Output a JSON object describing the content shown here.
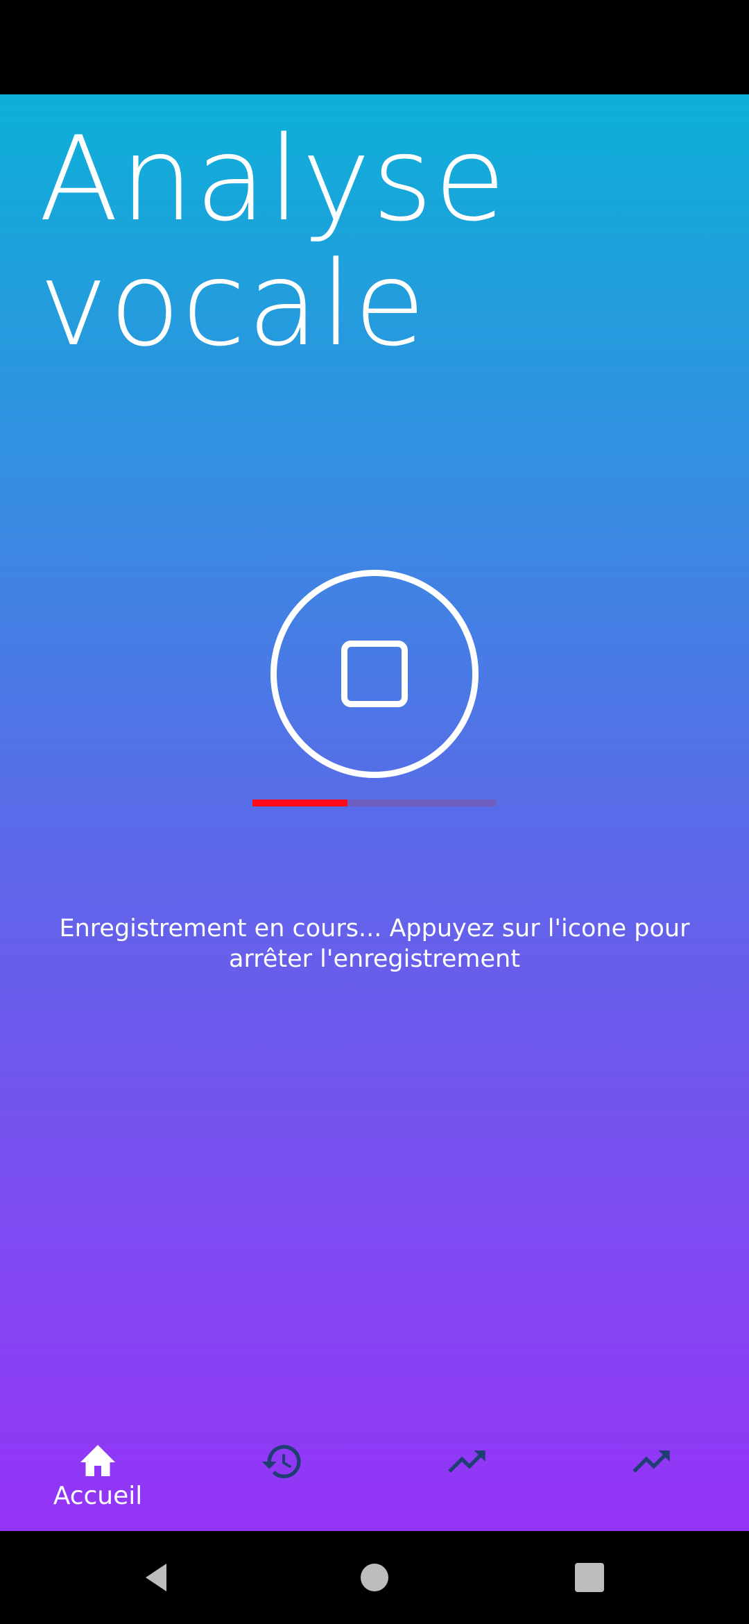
{
  "page": {
    "title_line1": "Analyse",
    "title_line2": "vocale"
  },
  "recording": {
    "status_text": "Enregistrement en cours... Appuyez sur l'icone pour arrêter l'enregistrement",
    "progress_fraction": 0.39,
    "progress_color": "#ff0a1a"
  },
  "bottom_nav": {
    "items": [
      {
        "label": "Accueil",
        "icon": "home-icon",
        "active": true
      },
      {
        "label": "",
        "icon": "history-icon",
        "active": false
      },
      {
        "label": "",
        "icon": "trending-up-icon",
        "active": false
      },
      {
        "label": "",
        "icon": "trending-up-icon",
        "active": false
      }
    ]
  },
  "colors": {
    "gradient_top": "#0db0d7",
    "gradient_bottom": "#9533f7",
    "inactive_icon": "#1f3f73"
  }
}
